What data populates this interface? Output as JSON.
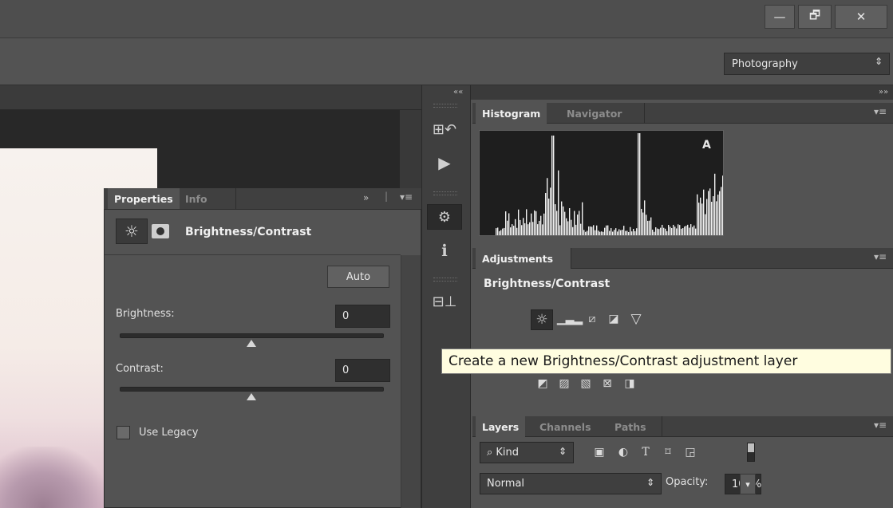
{
  "window": {
    "minimize_label": "—",
    "restore_label": "🗗",
    "close_label": "✕"
  },
  "options_bar": {
    "workspace_value": "Photography",
    "workspace_arrow": "⇕"
  },
  "collapse": {
    "left_arrows": "««",
    "right_arrows": "»»"
  },
  "properties_panel": {
    "tabs": [
      {
        "label": "Properties"
      },
      {
        "label": "Info"
      }
    ],
    "forward_arrows": "»",
    "menu_glyph": "▾≡",
    "title": "Brightness/Contrast",
    "auto_label": "Auto",
    "brightness_label": "Brightness:",
    "brightness_value": "0",
    "brightness_level": 0.5,
    "contrast_label": "Contrast:",
    "contrast_value": "0",
    "contrast_level": 0.5,
    "use_legacy_label": "Use Legacy",
    "use_legacy_checked": false
  },
  "histogram_panel": {
    "tabs": [
      {
        "label": "Histogram"
      },
      {
        "label": "Navigator"
      }
    ],
    "menu_glyph": "▾≡",
    "warning_glyph": "A"
  },
  "adjustments_panel": {
    "tab_label": "Adjustments",
    "menu_glyph": "▾≡",
    "heading": "Brightness/Contrast"
  },
  "layers_panel": {
    "tabs": [
      {
        "label": "Layers"
      },
      {
        "label": "Channels"
      },
      {
        "label": "Paths"
      }
    ],
    "menu_glyph": "▾≡",
    "filter_label": "⌕ Kind",
    "filter_arrow": "⇕",
    "blend_mode": "Normal",
    "blend_arrow": "⇕",
    "opacity_label": "Opacity:",
    "opacity_value": "100%",
    "opacity_arrow": "▾"
  },
  "tooltip": {
    "text": "Create a new Brightness/Contrast adjustment layer"
  },
  "colors": {
    "ui_bg": "#535353",
    "panel_dark": "#404040",
    "tooltip_bg": "#fffde0"
  }
}
